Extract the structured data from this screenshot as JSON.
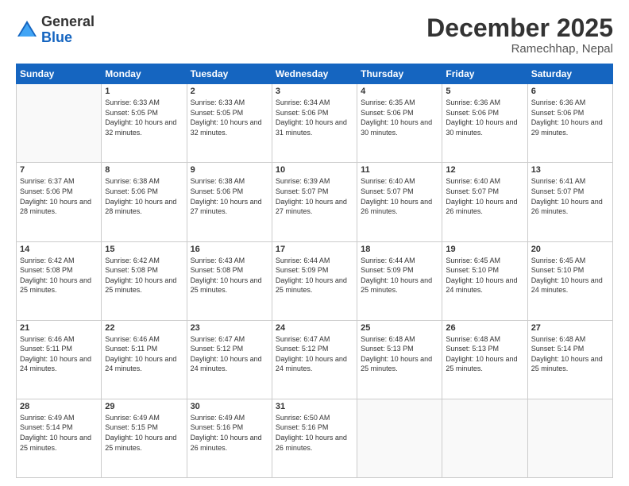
{
  "logo": {
    "general": "General",
    "blue": "Blue"
  },
  "title": "December 2025",
  "location": "Ramechhap, Nepal",
  "days_header": [
    "Sunday",
    "Monday",
    "Tuesday",
    "Wednesday",
    "Thursday",
    "Friday",
    "Saturday"
  ],
  "weeks": [
    [
      {
        "day": "",
        "empty": true
      },
      {
        "day": "1",
        "sunrise": "Sunrise: 6:33 AM",
        "sunset": "Sunset: 5:05 PM",
        "daylight": "Daylight: 10 hours and 32 minutes."
      },
      {
        "day": "2",
        "sunrise": "Sunrise: 6:33 AM",
        "sunset": "Sunset: 5:05 PM",
        "daylight": "Daylight: 10 hours and 32 minutes."
      },
      {
        "day": "3",
        "sunrise": "Sunrise: 6:34 AM",
        "sunset": "Sunset: 5:06 PM",
        "daylight": "Daylight: 10 hours and 31 minutes."
      },
      {
        "day": "4",
        "sunrise": "Sunrise: 6:35 AM",
        "sunset": "Sunset: 5:06 PM",
        "daylight": "Daylight: 10 hours and 30 minutes."
      },
      {
        "day": "5",
        "sunrise": "Sunrise: 6:36 AM",
        "sunset": "Sunset: 5:06 PM",
        "daylight": "Daylight: 10 hours and 30 minutes."
      },
      {
        "day": "6",
        "sunrise": "Sunrise: 6:36 AM",
        "sunset": "Sunset: 5:06 PM",
        "daylight": "Daylight: 10 hours and 29 minutes."
      }
    ],
    [
      {
        "day": "7",
        "sunrise": "Sunrise: 6:37 AM",
        "sunset": "Sunset: 5:06 PM",
        "daylight": "Daylight: 10 hours and 28 minutes."
      },
      {
        "day": "8",
        "sunrise": "Sunrise: 6:38 AM",
        "sunset": "Sunset: 5:06 PM",
        "daylight": "Daylight: 10 hours and 28 minutes."
      },
      {
        "day": "9",
        "sunrise": "Sunrise: 6:38 AM",
        "sunset": "Sunset: 5:06 PM",
        "daylight": "Daylight: 10 hours and 27 minutes."
      },
      {
        "day": "10",
        "sunrise": "Sunrise: 6:39 AM",
        "sunset": "Sunset: 5:07 PM",
        "daylight": "Daylight: 10 hours and 27 minutes."
      },
      {
        "day": "11",
        "sunrise": "Sunrise: 6:40 AM",
        "sunset": "Sunset: 5:07 PM",
        "daylight": "Daylight: 10 hours and 26 minutes."
      },
      {
        "day": "12",
        "sunrise": "Sunrise: 6:40 AM",
        "sunset": "Sunset: 5:07 PM",
        "daylight": "Daylight: 10 hours and 26 minutes."
      },
      {
        "day": "13",
        "sunrise": "Sunrise: 6:41 AM",
        "sunset": "Sunset: 5:07 PM",
        "daylight": "Daylight: 10 hours and 26 minutes."
      }
    ],
    [
      {
        "day": "14",
        "sunrise": "Sunrise: 6:42 AM",
        "sunset": "Sunset: 5:08 PM",
        "daylight": "Daylight: 10 hours and 25 minutes."
      },
      {
        "day": "15",
        "sunrise": "Sunrise: 6:42 AM",
        "sunset": "Sunset: 5:08 PM",
        "daylight": "Daylight: 10 hours and 25 minutes."
      },
      {
        "day": "16",
        "sunrise": "Sunrise: 6:43 AM",
        "sunset": "Sunset: 5:08 PM",
        "daylight": "Daylight: 10 hours and 25 minutes."
      },
      {
        "day": "17",
        "sunrise": "Sunrise: 6:44 AM",
        "sunset": "Sunset: 5:09 PM",
        "daylight": "Daylight: 10 hours and 25 minutes."
      },
      {
        "day": "18",
        "sunrise": "Sunrise: 6:44 AM",
        "sunset": "Sunset: 5:09 PM",
        "daylight": "Daylight: 10 hours and 25 minutes."
      },
      {
        "day": "19",
        "sunrise": "Sunrise: 6:45 AM",
        "sunset": "Sunset: 5:10 PM",
        "daylight": "Daylight: 10 hours and 24 minutes."
      },
      {
        "day": "20",
        "sunrise": "Sunrise: 6:45 AM",
        "sunset": "Sunset: 5:10 PM",
        "daylight": "Daylight: 10 hours and 24 minutes."
      }
    ],
    [
      {
        "day": "21",
        "sunrise": "Sunrise: 6:46 AM",
        "sunset": "Sunset: 5:11 PM",
        "daylight": "Daylight: 10 hours and 24 minutes."
      },
      {
        "day": "22",
        "sunrise": "Sunrise: 6:46 AM",
        "sunset": "Sunset: 5:11 PM",
        "daylight": "Daylight: 10 hours and 24 minutes."
      },
      {
        "day": "23",
        "sunrise": "Sunrise: 6:47 AM",
        "sunset": "Sunset: 5:12 PM",
        "daylight": "Daylight: 10 hours and 24 minutes."
      },
      {
        "day": "24",
        "sunrise": "Sunrise: 6:47 AM",
        "sunset": "Sunset: 5:12 PM",
        "daylight": "Daylight: 10 hours and 24 minutes."
      },
      {
        "day": "25",
        "sunrise": "Sunrise: 6:48 AM",
        "sunset": "Sunset: 5:13 PM",
        "daylight": "Daylight: 10 hours and 25 minutes."
      },
      {
        "day": "26",
        "sunrise": "Sunrise: 6:48 AM",
        "sunset": "Sunset: 5:13 PM",
        "daylight": "Daylight: 10 hours and 25 minutes."
      },
      {
        "day": "27",
        "sunrise": "Sunrise: 6:48 AM",
        "sunset": "Sunset: 5:14 PM",
        "daylight": "Daylight: 10 hours and 25 minutes."
      }
    ],
    [
      {
        "day": "28",
        "sunrise": "Sunrise: 6:49 AM",
        "sunset": "Sunset: 5:14 PM",
        "daylight": "Daylight: 10 hours and 25 minutes."
      },
      {
        "day": "29",
        "sunrise": "Sunrise: 6:49 AM",
        "sunset": "Sunset: 5:15 PM",
        "daylight": "Daylight: 10 hours and 25 minutes."
      },
      {
        "day": "30",
        "sunrise": "Sunrise: 6:49 AM",
        "sunset": "Sunset: 5:16 PM",
        "daylight": "Daylight: 10 hours and 26 minutes."
      },
      {
        "day": "31",
        "sunrise": "Sunrise: 6:50 AM",
        "sunset": "Sunset: 5:16 PM",
        "daylight": "Daylight: 10 hours and 26 minutes."
      },
      {
        "day": "",
        "empty": true
      },
      {
        "day": "",
        "empty": true
      },
      {
        "day": "",
        "empty": true
      }
    ]
  ]
}
